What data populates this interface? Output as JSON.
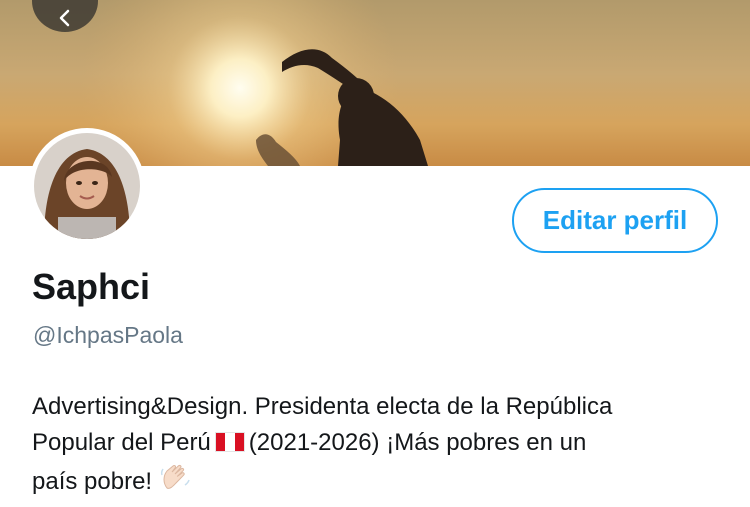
{
  "banner": {
    "description_icon": "sunset-silhouette-banner"
  },
  "nav": {
    "back_icon": "chevron-left-icon"
  },
  "profile": {
    "edit_button_label": "Editar perfil",
    "display_name": "Saphci",
    "handle": "@IchpasPaola",
    "bio_line1": "Advertising&Design. Presidenta electa de la República",
    "bio_line2_part1": "Popular del Perú",
    "bio_line2_part2": "(2021-2026) ¡Más pobres en un",
    "bio_line3": "país pobre!",
    "bio_emoji_flag": "peru-flag-icon",
    "bio_emoji_wave": "waving-hand-icon"
  },
  "colors": {
    "accent": "#1da1f2",
    "secondary_text": "#657786",
    "primary_text": "#14171a"
  }
}
